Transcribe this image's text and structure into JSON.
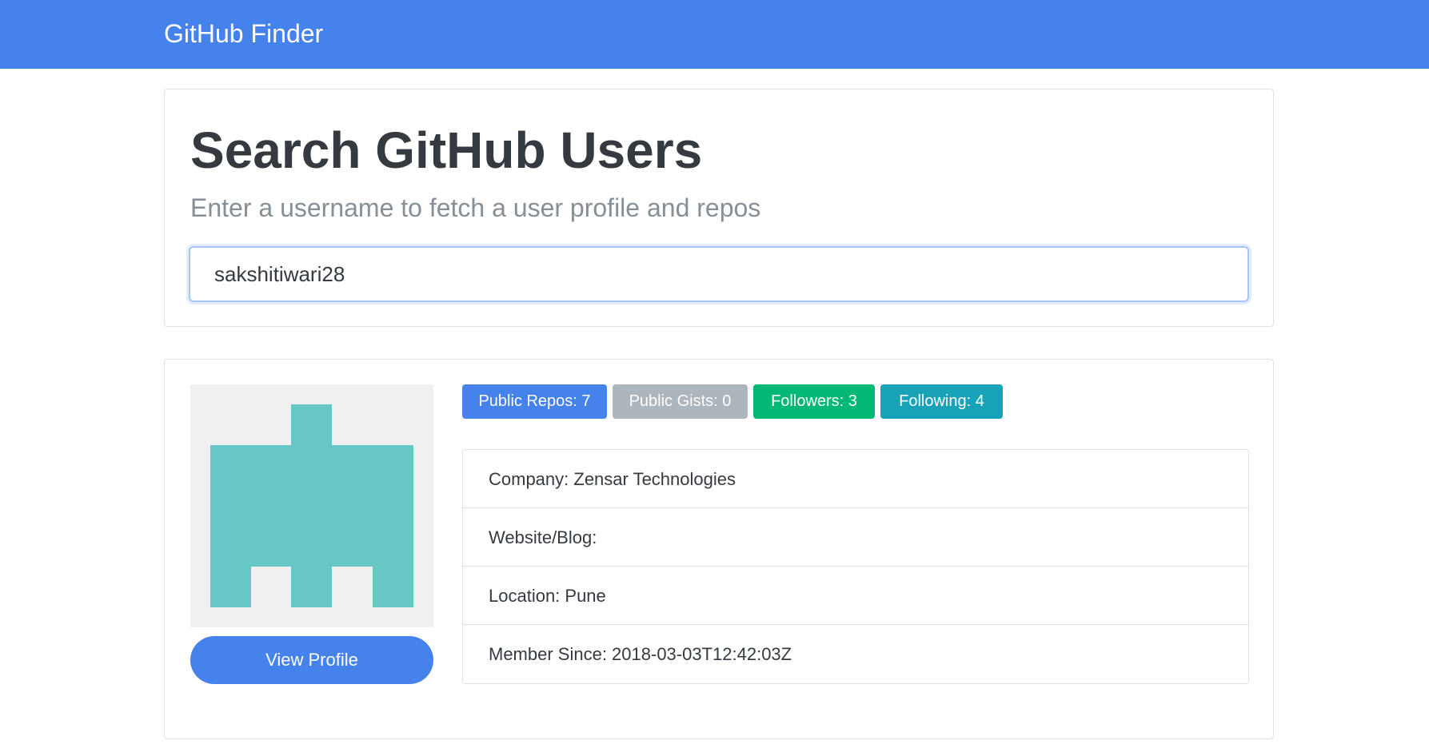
{
  "navbar": {
    "brand": "GitHub Finder",
    "color": "#4582ec"
  },
  "search": {
    "title": "Search GitHub Users",
    "subtitle": "Enter a username to fetch a user profile and repos",
    "input_value": "sakshitiwari28"
  },
  "profile": {
    "avatar_icon": "identicon-avatar",
    "avatar_color": "#66c7c4",
    "view_button_label": "View Profile",
    "badges": [
      {
        "label": "Public Repos: 7",
        "color": "#4582ec"
      },
      {
        "label": "Public Gists: 0",
        "color": "#adb5bd"
      },
      {
        "label": "Followers: 3",
        "color": "#02b875"
      },
      {
        "label": "Following: 4",
        "color": "#17a2b8"
      }
    ],
    "details": [
      {
        "label": "Company: Zensar Technologies"
      },
      {
        "label": "Website/Blog:"
      },
      {
        "label": "Location: Pune"
      },
      {
        "label": "Member Since: 2018-03-03T12:42:03Z"
      }
    ]
  }
}
